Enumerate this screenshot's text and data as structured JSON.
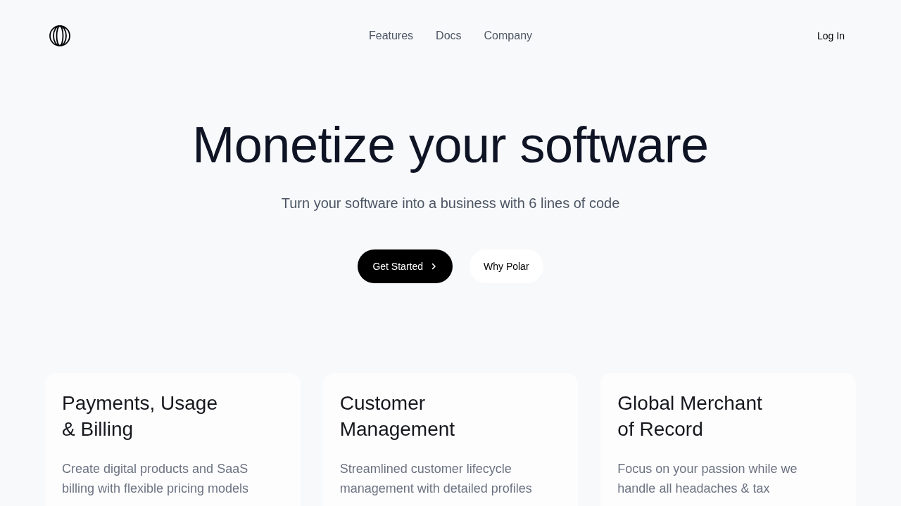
{
  "header": {
    "nav": [
      "Features",
      "Docs",
      "Company"
    ],
    "login": "Log In"
  },
  "hero": {
    "title": "Monetize your software",
    "subtitle": "Turn your software into a business with 6 lines of code",
    "buttons": [
      {
        "label": "Get Started",
        "kind": "primary"
      },
      {
        "label": "Why Polar",
        "kind": "secondary"
      }
    ]
  },
  "features": [
    {
      "title": "Payments, Usage\n& Billing",
      "description": "Create digital products and SaaS\nbilling with flexible pricing models"
    },
    {
      "title": "Customer\nManagement",
      "description": "Streamlined customer lifecycle\nmanagement with detailed profiles"
    },
    {
      "title": "Global Merchant\nof Record",
      "description": "Focus on your passion while we\nhandle all headaches & tax"
    }
  ]
}
